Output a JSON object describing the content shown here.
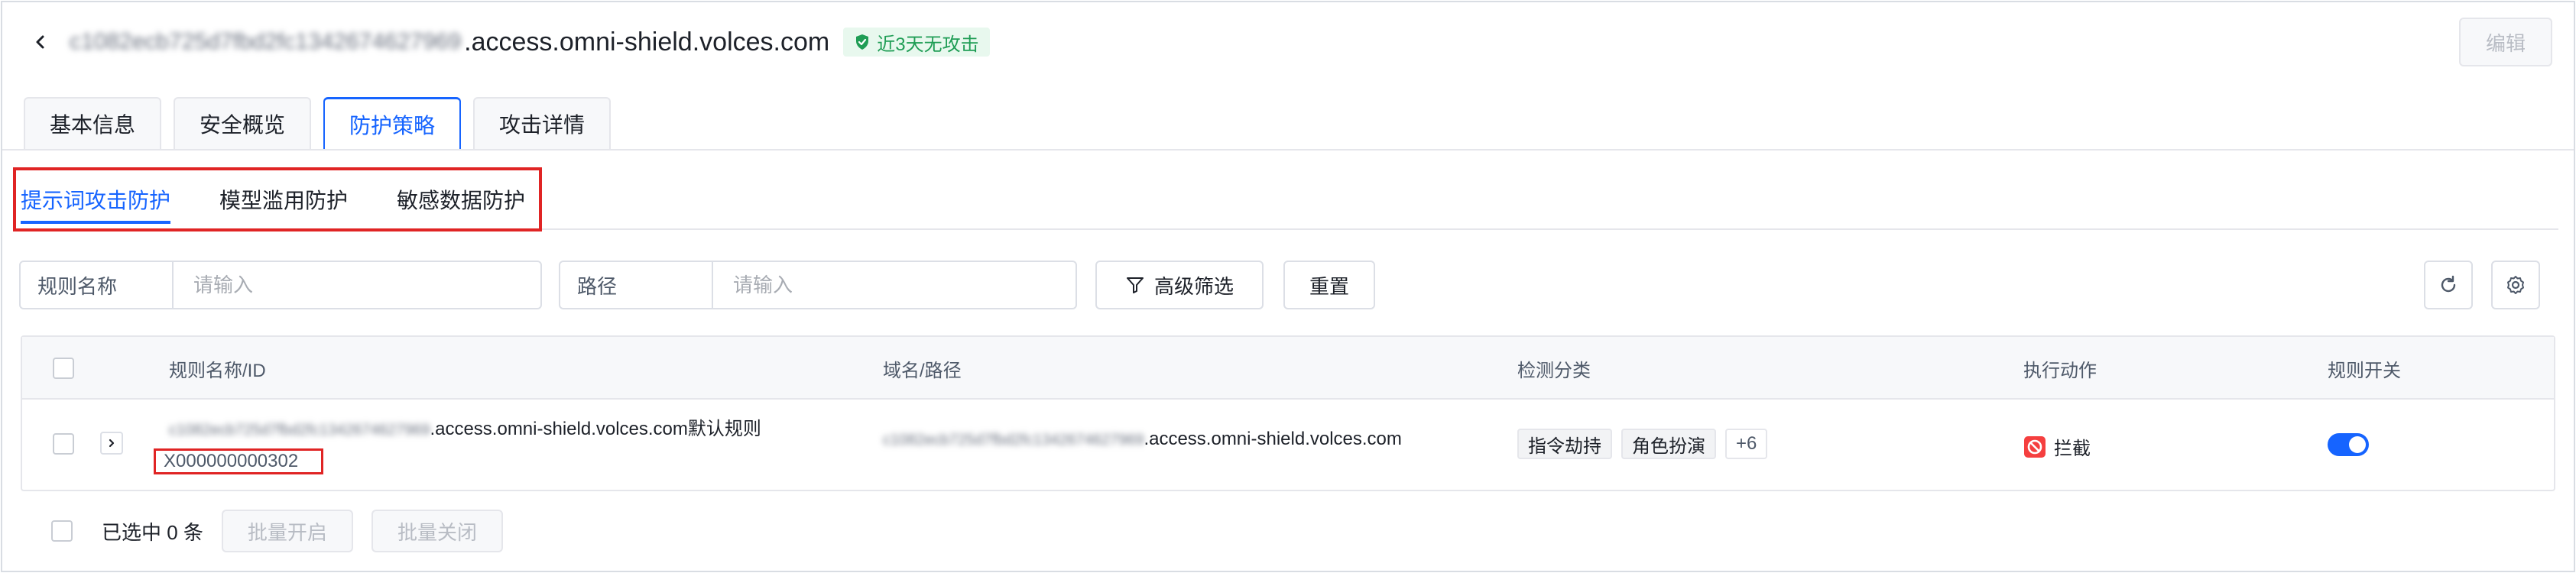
{
  "header": {
    "title_blurred_prefix": "c1082ecb725d7fbd2fc1342674627969",
    "title_domain": ".access.omni-shield.volces.com",
    "status_badge": "近3天无攻击",
    "edit_label": "编辑"
  },
  "tabs": [
    {
      "label": "基本信息",
      "active": false
    },
    {
      "label": "安全概览",
      "active": false
    },
    {
      "label": "防护策略",
      "active": true
    },
    {
      "label": "攻击详情",
      "active": false
    }
  ],
  "subtabs": [
    {
      "label": "提示词攻击防护",
      "active": true
    },
    {
      "label": "模型滥用防护",
      "active": false
    },
    {
      "label": "敏感数据防护",
      "active": false
    }
  ],
  "filters": {
    "rule_name_label": "规则名称",
    "rule_name_placeholder": "请输入",
    "path_label": "路径",
    "path_placeholder": "请输入",
    "advanced_filter_label": "高级筛选",
    "reset_label": "重置"
  },
  "table": {
    "columns": [
      "规则名称/ID",
      "域名/路径",
      "检测分类",
      "执行动作",
      "规则开关"
    ],
    "rows": [
      {
        "name_blurred_prefix": "c1082ecb725d7fbd2fc1342674627969",
        "name_suffix": ".access.omni-shield.volces.com默认规则",
        "id": "X000000000302",
        "domain_blurred_prefix": "c1082ecb725d7fbd2fc1342674627969",
        "domain_suffix": ".access.omni-shield.volces.com",
        "tags": [
          "指令劫持",
          "角色扮演"
        ],
        "more_tags": "+6",
        "action": "拦截",
        "enabled": true
      }
    ]
  },
  "footer": {
    "selected_text": "已选中 0 条",
    "batch_on_label": "批量开启",
    "batch_off_label": "批量关闭"
  },
  "colors": {
    "primary": "#1664ff",
    "highlight_red": "#e02424",
    "badge_green": "#1f9d55"
  }
}
